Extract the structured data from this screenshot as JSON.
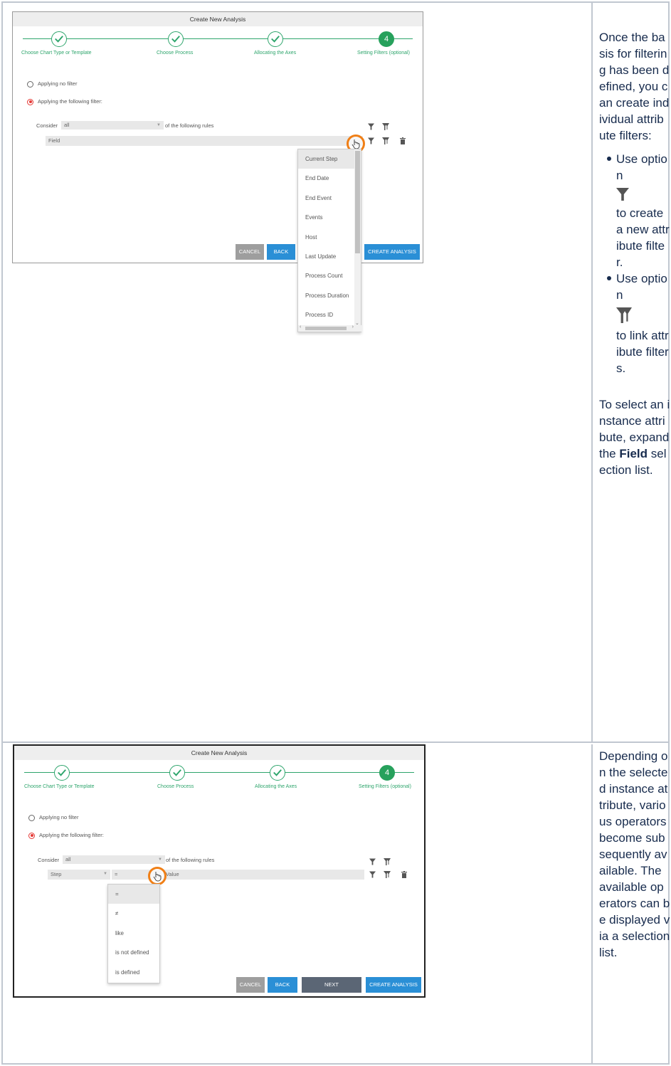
{
  "row1": {
    "dialog": {
      "title": "Create New Analysis",
      "steps": [
        {
          "label": "Choose Chart Type or Template",
          "state": "done"
        },
        {
          "label": "Choose Process",
          "state": "done"
        },
        {
          "label": "Allocating the Axes",
          "state": "done"
        },
        {
          "label": "Setting Filters (optional)",
          "state": "active",
          "number": "4"
        }
      ],
      "radio_no_filter": "Applying no filter",
      "radio_following": "Applying the following filter:",
      "consider_label": "Consider",
      "consider_value": "all",
      "of_following_rules": "of the following rules",
      "field_placeholder": "Field",
      "dropdown_items": [
        "Current Step",
        "End Date",
        "End Event",
        "Events",
        "Host",
        "Last Update",
        "Process Count",
        "Process Duration",
        "Process ID"
      ],
      "dropdown_highlighted": "Current Step",
      "buttons": {
        "cancel": "CANCEL",
        "back": "BACK",
        "create": "CREATE ANALYSIS"
      }
    },
    "text": {
      "intro": "Once the basis for filtering has been defined, you can create individual attribute filters:",
      "bullet1_pre": "Use option",
      "bullet1_post": "to create a new attribute filter.",
      "bullet2_pre": "Use option",
      "bullet2_post": "to link attribute filters.",
      "outro_pre": "To select an instance attribute, expand the",
      "outro_bold": "Field",
      "outro_post": "selection list."
    }
  },
  "row2": {
    "dialog": {
      "title": "Create New Analysis",
      "steps": [
        {
          "label": "Choose Chart Type or Template",
          "state": "done"
        },
        {
          "label": "Choose Process",
          "state": "done"
        },
        {
          "label": "Allocating the Axes",
          "state": "done"
        },
        {
          "label": "Setting Filters (optional)",
          "state": "active",
          "number": "4"
        }
      ],
      "radio_no_filter": "Applying no filter",
      "radio_following": "Applying the following filter:",
      "consider_label": "Consider",
      "consider_value": "all",
      "of_following_rules": "of the following rules",
      "field_value": "Step",
      "operator_value": "=",
      "value_placeholder": "Value",
      "operator_items": [
        "=",
        "≠",
        "like",
        "is not defined",
        "is defined"
      ],
      "operator_highlighted": "=",
      "buttons": {
        "cancel": "CANCEL",
        "back": "BACK",
        "next": "NEXT",
        "create": "CREATE ANALYSIS"
      }
    },
    "text": {
      "body": "Depending on the selected instance attribute, various operators become subsequently available. The available operators can be displayed via a selection list."
    }
  },
  "colors": {
    "accent_green": "#27a15c",
    "button_blue": "#2a8fd6",
    "cursor_orange": "#f07f16",
    "radio_red": "#e53935"
  },
  "icons": [
    "check-icon",
    "filter-icon",
    "link-filter-icon",
    "trash-icon",
    "caret-down-icon",
    "hand-cursor-icon"
  ]
}
